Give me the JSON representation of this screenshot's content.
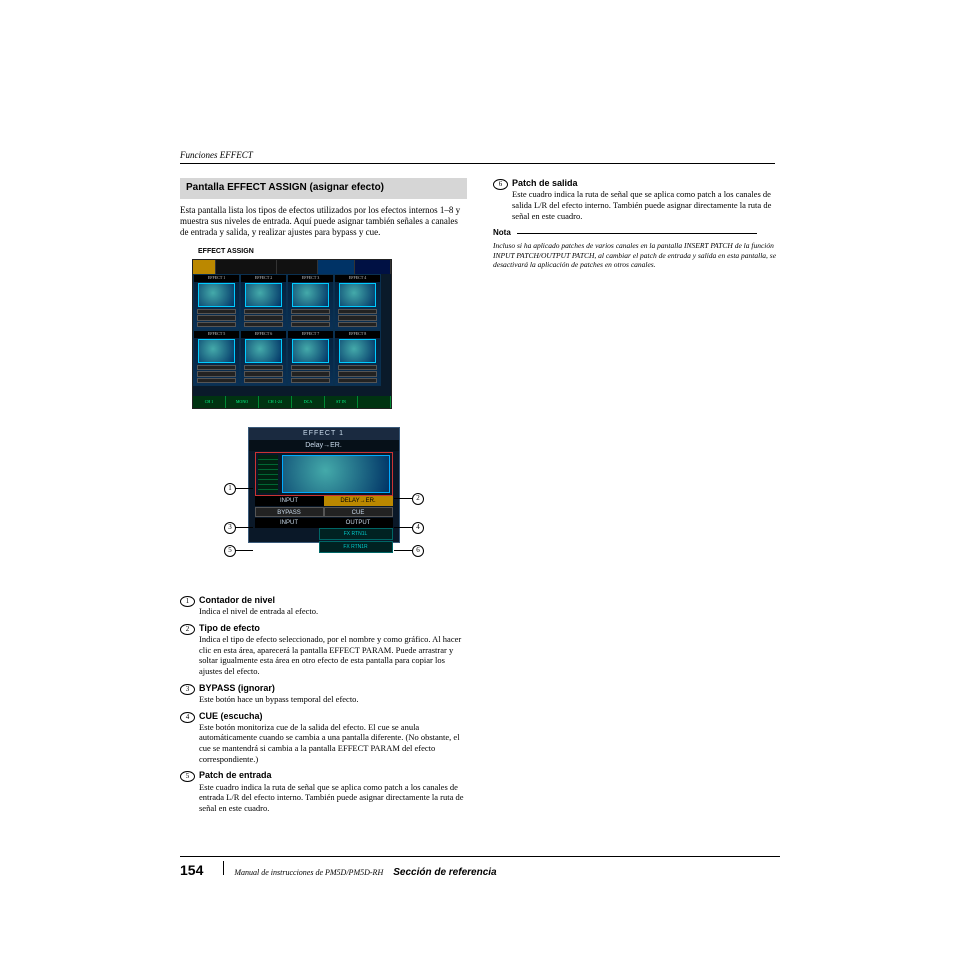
{
  "running_head": "Funciones EFFECT",
  "left": {
    "box_title": "Pantalla EFFECT ASSIGN (asignar efecto)",
    "intro": "Esta pantalla lista los tipos de efectos utilizados por los efectos internos 1–8 y muestra sus niveles de entrada. Aquí puede asignar también señales a canales de entrada y salida, y realizar ajustes para bypass y cue.",
    "fig_caption": "EFFECT ASSIGN",
    "fig_main": {
      "cells": [
        "EFFECT 1",
        "EFFECT 2",
        "EFFECT 3",
        "EFFECT 4",
        "EFFECT 5",
        "EFFECT 6",
        "EFFECT 7",
        "EFFECT 8"
      ],
      "footer": [
        "CH 1",
        "MONO",
        "CH 1-24",
        "DCA",
        "ST IN",
        ""
      ]
    },
    "detail": {
      "title": "EFFECT 1",
      "sub": "Delay→ER.",
      "row1a": "INPUT",
      "row1b": "DELAY→ER.",
      "row2a": "BYPASS",
      "row2b": "CUE",
      "row3a": "INPUT",
      "row3b": "OUTPUT",
      "patch1": "FX RTN1L",
      "patch2": "FX RTN1R"
    },
    "callouts": [
      "1",
      "2",
      "3",
      "4",
      "5",
      "6"
    ],
    "defs": [
      {
        "n": "1",
        "title": "Contador de nivel",
        "text": "Indica el nivel de entrada al efecto."
      },
      {
        "n": "2",
        "title": "Tipo de efecto",
        "text": "Indica el tipo de efecto seleccionado, por el nombre y como gráfico. Al hacer clic en esta área, aparecerá la pantalla EFFECT PARAM. Puede arrastrar y soltar igualmente esta área en otro efecto de esta pantalla para copiar los ajustes del efecto."
      },
      {
        "n": "3",
        "title": "BYPASS (ignorar)",
        "text": "Este botón hace un bypass temporal del efecto."
      },
      {
        "n": "4",
        "title": "CUE (escucha)",
        "text": "Este botón monitoriza cue de la salida del efecto. El cue se anula automáticamente cuando se cambia a una pantalla diferente. (No obstante, el cue se mantendrá si cambia a la pantalla EFFECT PARAM del efecto correspondiente.)"
      },
      {
        "n": "5",
        "title": "Patch de entrada",
        "text": "Este cuadro indica la ruta de señal que se aplica como patch a los canales de entrada L/R del efecto interno. También puede asignar directamente la ruta de señal en este cuadro."
      }
    ]
  },
  "right": {
    "def6": {
      "n": "6",
      "title": "Patch de salida",
      "text": "Este cuadro indica la ruta de señal que se aplica como patch a los canales de salida L/R del efecto interno. También puede asignar directamente la ruta de señal en este cuadro."
    },
    "note_label": "Nota",
    "note_text": "Incluso si ha aplicado patches de varios canales en la pantalla INSERT PATCH de la función INPUT PATCH/OUTPUT PATCH, al cambiar el patch de entrada y salida en esta pantalla, se desactivará la aplicación de patches en otros canales."
  },
  "footer": {
    "page": "154",
    "mid": "Manual de instrucciones de PM5D/PM5D-RH",
    "section": "Sección de referencia"
  }
}
